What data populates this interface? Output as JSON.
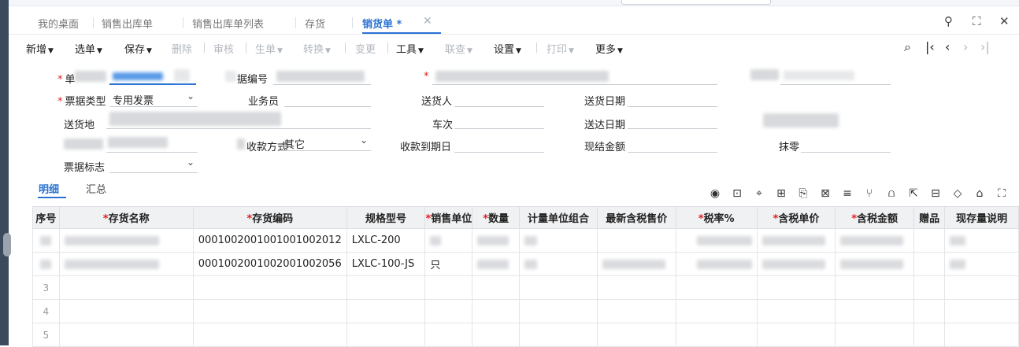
{
  "tabs": [
    {
      "label": "我的桌面",
      "active": false
    },
    {
      "label": "销售出库单",
      "active": false
    },
    {
      "label": "销售出库单列表",
      "active": false
    },
    {
      "label": "存货",
      "active": false
    },
    {
      "label": "销货单 *",
      "active": true
    }
  ],
  "toolbar": {
    "buttons": [
      {
        "label": "新增",
        "enabled": true,
        "dropdown": true
      },
      {
        "label": "选单",
        "enabled": true,
        "dropdown": true
      },
      {
        "label": "保存",
        "enabled": true,
        "dropdown": true
      },
      {
        "label": "删除",
        "enabled": false,
        "dropdown": false
      },
      {
        "label": "审核",
        "enabled": false,
        "dropdown": false
      },
      {
        "label": "生单",
        "enabled": false,
        "dropdown": true
      },
      {
        "label": "转换",
        "enabled": false,
        "dropdown": true
      },
      {
        "label": "变更",
        "enabled": false,
        "dropdown": false
      },
      {
        "label": "工具",
        "enabled": true,
        "dropdown": true
      },
      {
        "label": "联查",
        "enabled": false,
        "dropdown": true
      },
      {
        "label": "设置",
        "enabled": true,
        "dropdown": true
      },
      {
        "label": "打印",
        "enabled": false,
        "dropdown": true
      },
      {
        "label": "更多",
        "enabled": true,
        "dropdown": true
      }
    ]
  },
  "form": {
    "label_danju": "单",
    "label_bianhao": "据编号",
    "label_piaojuleixing": "票据类型",
    "value_piaojuleixing": "专用发票",
    "label_yewuyuan": "业务员",
    "label_songhuoren": "送货人",
    "label_songhuoriqi": "送货日期",
    "label_songhuodi": "送货地",
    "label_checi": "车次",
    "label_songdariqi": "送达日期",
    "label_shoukuanfangshi": "收款方式",
    "value_shoukuanfangshi": "其它",
    "label_shoukuandaoqiri": "收款到期日",
    "label_xianjiejine": "现结金额",
    "label_moling": "抹零",
    "label_piaojubiaozhi": "票据标志"
  },
  "subtabs": [
    {
      "label": "明细",
      "active": true
    },
    {
      "label": "汇总",
      "active": false
    }
  ],
  "grid": {
    "columns": [
      {
        "label": "序号",
        "required": false
      },
      {
        "label": "存货名称",
        "required": true
      },
      {
        "label": "存货编码",
        "required": true
      },
      {
        "label": "规格型号",
        "required": false
      },
      {
        "label": "销售单位",
        "required": true
      },
      {
        "label": "数量",
        "required": true
      },
      {
        "label": "计量单位组合",
        "required": false
      },
      {
        "label": "最新含税售价",
        "required": false
      },
      {
        "label": "税率%",
        "required": true
      },
      {
        "label": "含税单价",
        "required": true
      },
      {
        "label": "含税金额",
        "required": true
      },
      {
        "label": "赠品",
        "required": false
      },
      {
        "label": "现存量说明",
        "required": false
      }
    ],
    "rows": [
      {
        "no": "",
        "code": "000100200100100​1002012",
        "spec": "LXLC-200",
        "unit": ""
      },
      {
        "no": "",
        "code": "0001002001002001002056",
        "spec": "LXLC-100-JS",
        "unit": "只"
      },
      {
        "no": "3",
        "code": "",
        "spec": "",
        "unit": ""
      },
      {
        "no": "4",
        "code": "",
        "spec": "",
        "unit": ""
      },
      {
        "no": "5",
        "code": "",
        "spec": "",
        "unit": ""
      }
    ]
  }
}
